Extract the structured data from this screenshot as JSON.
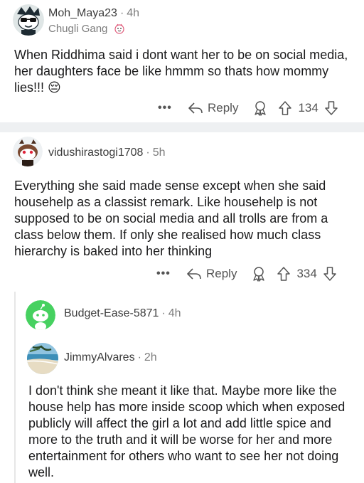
{
  "comments": [
    {
      "username": "Moh_Maya23",
      "time": "4h",
      "flair": "Chugli Gang",
      "body": "When Riddhima said i dont want her to be on social media, her daughters face be like hmmm so thats how mommy lies!!! 😔",
      "reply_label": "Reply",
      "votes": "134"
    },
    {
      "username": "vidushirastogi1708",
      "time": "5h",
      "body": "Everything she said made sense except when she said househelp as a classist remark. Like househelp is not supposed to be on social media and all trolls are from a class below them. If only she realised how much class hierarchy is baked into her thinking",
      "reply_label": "Reply",
      "votes": "334"
    },
    {
      "username": "Budget-Ease-5871",
      "time": "4h"
    },
    {
      "username": "JimmyAlvares",
      "time": "2h",
      "body": "I don't think she meant it like that. Maybe more like the house help has more inside scoop which when exposed publicly will affect the girl a lot and add little spice and more to the truth and it will be worse for her and more entertainment for others who want to see her not doing well."
    }
  ],
  "icons": [
    "avatar-snoo-sunglasses",
    "avatar-snoo-mascot",
    "avatar-snoo-green",
    "avatar-beach-photo",
    "more-icon",
    "reply-arrow-icon",
    "award-icon",
    "upvote-icon",
    "downvote-icon",
    "flair-emoji-icon"
  ],
  "colors": {
    "divider": "#eef0f2",
    "text": "#1a1a1b",
    "muted": "#7c7c7c",
    "snoo_green": "#46d160"
  }
}
